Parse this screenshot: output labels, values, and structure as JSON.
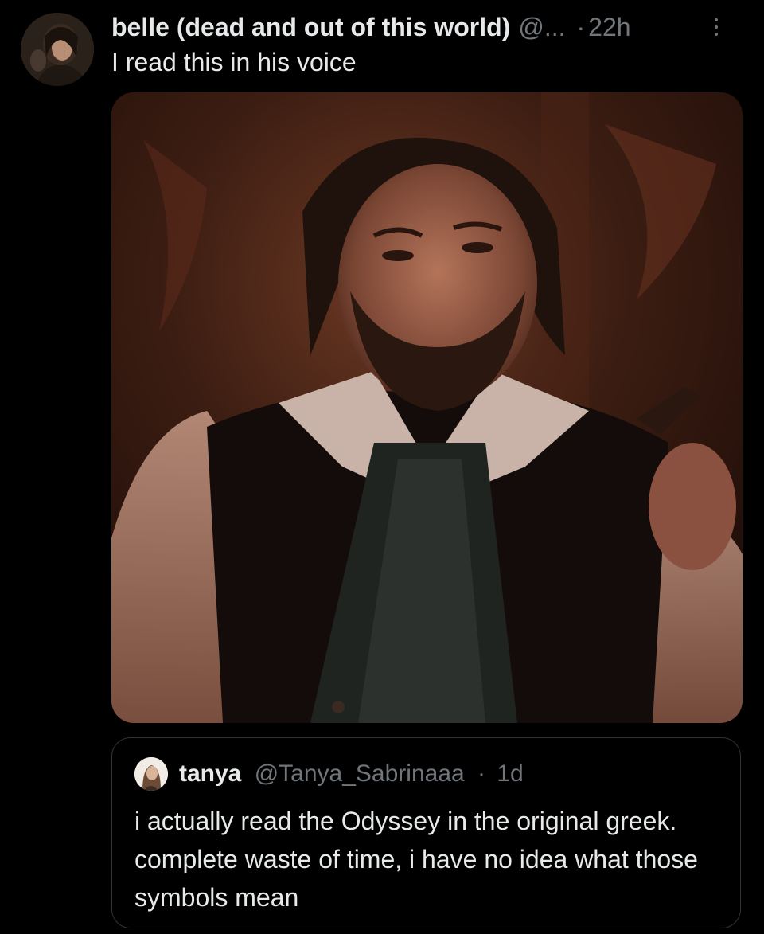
{
  "post": {
    "author": {
      "display_name": "belle (dead and out of this world)",
      "handle": "@...",
      "avatar_icon": "user-avatar"
    },
    "separator": "·",
    "time": "22h",
    "more_icon": "more-vertical-icon",
    "text": "I read this in his voice",
    "media": {
      "kind": "photo"
    }
  },
  "quoted_post": {
    "author": {
      "display_name": "tanya",
      "handle": "@Tanya_Sabrinaaa",
      "avatar_icon": "user-avatar"
    },
    "separator": "·",
    "time": "1d",
    "text": "i actually read the Odyssey in the original greek. complete waste of time, i have no idea what those symbols mean"
  },
  "colors": {
    "background": "#000000",
    "primary_text": "#e7e9ea",
    "secondary_text": "#71767b",
    "border": "#2f3336"
  }
}
